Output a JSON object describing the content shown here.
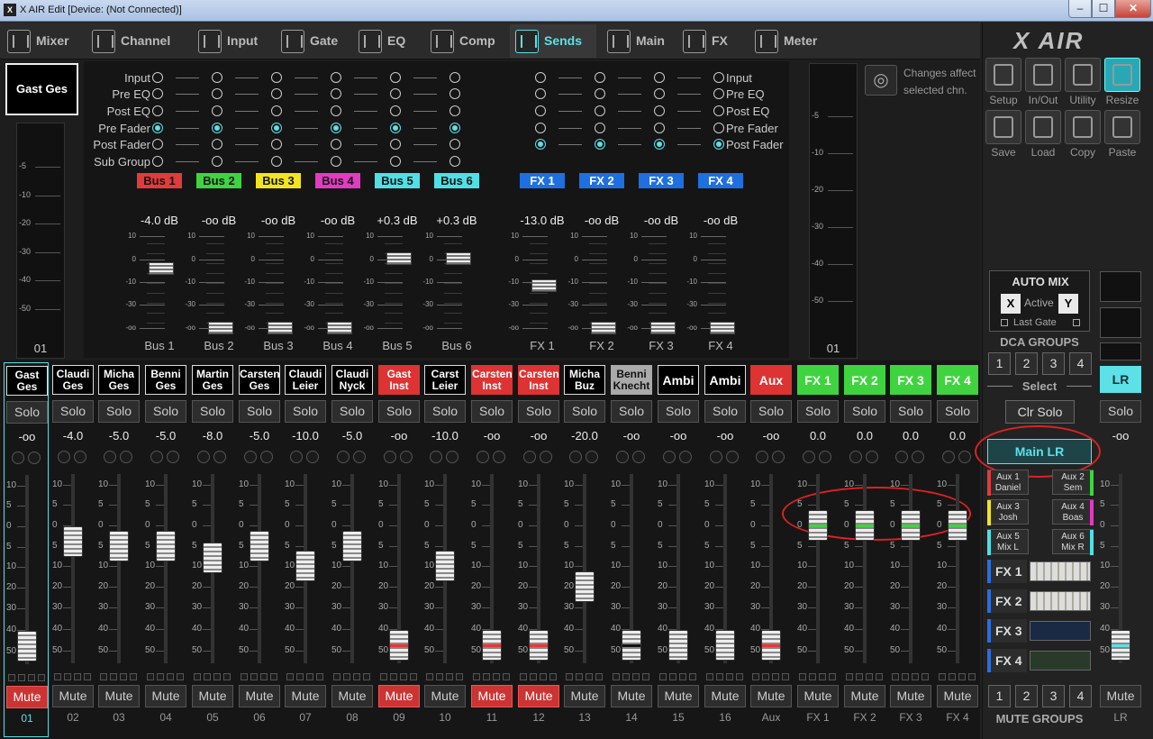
{
  "window": {
    "title": "X AIR Edit [Device: (Not Connected)]",
    "icon": "X",
    "min": "–",
    "max": "☐",
    "close": "✕"
  },
  "tabs": [
    {
      "label": "Mixer",
      "icon": "mixer-icon"
    },
    {
      "label": "Channel",
      "icon": "channel-icon"
    },
    {
      "label": "Input",
      "icon": "input-icon"
    },
    {
      "label": "Gate",
      "icon": "gate-icon"
    },
    {
      "label": "EQ",
      "icon": "eq-icon"
    },
    {
      "label": "Comp",
      "icon": "comp-icon"
    },
    {
      "label": "Sends",
      "icon": "sends-icon"
    },
    {
      "label": "Main",
      "icon": "main-icon"
    },
    {
      "label": "FX",
      "icon": "fx-icon"
    },
    {
      "label": "Meter",
      "icon": "meter-icon"
    }
  ],
  "active_tab": "Sends",
  "selected_channel": {
    "name": "Gast  Ges",
    "number": "01"
  },
  "meter_scale": [
    "-5",
    "-10",
    "-20",
    "-30",
    "-40",
    "-50"
  ],
  "right_meter_scale": [
    "-5",
    "-10",
    "-20",
    "-30",
    "-40",
    "-50"
  ],
  "tap_labels": [
    "Input",
    "Pre EQ",
    "Post EQ",
    "Pre Fader",
    "Post Fader",
    "Sub Group"
  ],
  "fx_tap_labels": [
    "Input",
    "Pre EQ",
    "Post EQ",
    "Pre Fader",
    "Post Fader"
  ],
  "buses": [
    {
      "name": "Bus 1",
      "color": "#e23b3b",
      "db": "-4.0 dB",
      "level": -4.0,
      "tap": "Pre Fader"
    },
    {
      "name": "Bus 2",
      "color": "#3fd43f",
      "db": "-oo dB",
      "level": null,
      "tap": "Pre Fader"
    },
    {
      "name": "Bus 3",
      "color": "#f2e41e",
      "db": "-oo dB",
      "level": null,
      "tap": "Pre Fader"
    },
    {
      "name": "Bus 4",
      "color": "#e23bc2",
      "db": "-oo dB",
      "level": null,
      "tap": "Pre Fader"
    },
    {
      "name": "Bus 5",
      "color": "#4fe0e6",
      "db": "+0.3 dB",
      "level": 0.3,
      "tap": "Pre Fader"
    },
    {
      "name": "Bus 6",
      "color": "#4fe0e6",
      "db": "+0.3 dB",
      "level": 0.3,
      "tap": "Pre Fader"
    }
  ],
  "fx_sends": [
    {
      "name": "FX 1",
      "color": "#1e6fe0",
      "db": "-13.0 dB",
      "level": -13.0,
      "tap": "Post Fader"
    },
    {
      "name": "FX 2",
      "color": "#1e6fe0",
      "db": "-oo dB",
      "level": null,
      "tap": "Post Fader"
    },
    {
      "name": "FX 3",
      "color": "#1e6fe0",
      "db": "-oo dB",
      "level": null,
      "tap": "Post Fader"
    },
    {
      "name": "FX 4",
      "color": "#1e6fe0",
      "db": "-oo dB",
      "level": null,
      "tap": "Post Fader"
    }
  ],
  "send_scale": [
    "10",
    "0",
    "-10",
    "-30",
    "-oo"
  ],
  "changes_note": "Changes affect selected chn.",
  "strip_scale": [
    "10",
    "5",
    "0",
    "5",
    "10",
    "20",
    "30",
    "40",
    "50"
  ],
  "channels": [
    {
      "name": "Gast\nGes",
      "solo": "Solo",
      "value": "-oo",
      "level": -90,
      "mute": "Mute",
      "muted": true,
      "number": "01",
      "name_bg": "#000",
      "line": "",
      "selected": true
    },
    {
      "name": "Claudi\nGes",
      "solo": "Solo",
      "value": "-4.0",
      "level": -4.0,
      "mute": "Mute",
      "muted": false,
      "number": "02",
      "name_bg": "#000",
      "line": ""
    },
    {
      "name": "Micha\nGes",
      "solo": "Solo",
      "value": "-5.0",
      "level": -5.0,
      "mute": "Mute",
      "muted": false,
      "number": "03",
      "name_bg": "#000",
      "line": ""
    },
    {
      "name": "Benni\nGes",
      "solo": "Solo",
      "value": "-5.0",
      "level": -5.0,
      "mute": "Mute",
      "muted": false,
      "number": "04",
      "name_bg": "#000",
      "line": ""
    },
    {
      "name": "Martin\nGes",
      "solo": "Solo",
      "value": "-8.0",
      "level": -8.0,
      "mute": "Mute",
      "muted": false,
      "number": "05",
      "name_bg": "#000",
      "line": ""
    },
    {
      "name": "Carsten\nGes",
      "solo": "Solo",
      "value": "-5.0",
      "level": -5.0,
      "mute": "Mute",
      "muted": false,
      "number": "06",
      "name_bg": "#000",
      "line": ""
    },
    {
      "name": "Claudi\nLeier",
      "solo": "Solo",
      "value": "-10.0",
      "level": -10.0,
      "mute": "Mute",
      "muted": false,
      "number": "07",
      "name_bg": "#000",
      "line": ""
    },
    {
      "name": "Claudi\nNyck",
      "solo": "Solo",
      "value": "-5.0",
      "level": -5.0,
      "mute": "Mute",
      "muted": false,
      "number": "08",
      "name_bg": "#000",
      "line": ""
    },
    {
      "name": "Gast\nInst",
      "solo": "Solo",
      "value": "-oo",
      "level": -90,
      "mute": "Mute",
      "muted": true,
      "number": "09",
      "name_bg": "#d33",
      "line": "#e33"
    },
    {
      "name": "Carst\nLeier",
      "solo": "Solo",
      "value": "-10.0",
      "level": -10.0,
      "mute": "Mute",
      "muted": false,
      "number": "10",
      "name_bg": "#000",
      "line": ""
    },
    {
      "name": "Carsten\nInst",
      "solo": "Solo",
      "value": "-oo",
      "level": -90,
      "mute": "Mute",
      "muted": true,
      "number": "11",
      "name_bg": "#d33",
      "line": "#e33"
    },
    {
      "name": "Carsten\nInst",
      "solo": "Solo",
      "value": "-oo",
      "level": -90,
      "mute": "Mute",
      "muted": true,
      "number": "12",
      "name_bg": "#d33",
      "line": "#e33"
    },
    {
      "name": "Micha\nBuz",
      "solo": "Solo",
      "value": "-20.0",
      "level": -20.0,
      "mute": "Mute",
      "muted": false,
      "number": "13",
      "name_bg": "#000",
      "line": ""
    },
    {
      "name": "Benni\nKnecht",
      "solo": "Solo",
      "value": "-oo",
      "level": -90,
      "mute": "Mute",
      "muted": false,
      "number": "14",
      "name_bg": "#aaa",
      "line": "#111"
    },
    {
      "name": "Ambi",
      "solo": "Solo",
      "value": "-oo",
      "level": -90,
      "mute": "Mute",
      "muted": false,
      "number": "15",
      "name_bg": "#000",
      "line": ""
    },
    {
      "name": "Ambi",
      "solo": "Solo",
      "value": "-oo",
      "level": -90,
      "mute": "Mute",
      "muted": false,
      "number": "16",
      "name_bg": "#000",
      "line": ""
    },
    {
      "name": "Aux",
      "solo": "Solo",
      "value": "-oo",
      "level": -90,
      "mute": "Mute",
      "muted": false,
      "number": "Aux",
      "name_bg": "#d33",
      "line": "#e33"
    },
    {
      "name": "FX 1",
      "solo": "Solo",
      "value": "0.0",
      "level": 0,
      "mute": "Mute",
      "muted": false,
      "number": "FX 1",
      "name_bg": "#3fd43f",
      "line": "#3fd43f"
    },
    {
      "name": "FX 2",
      "solo": "Solo",
      "value": "0.0",
      "level": 0,
      "mute": "Mute",
      "muted": false,
      "number": "FX 2",
      "name_bg": "#3fd43f",
      "line": "#3fd43f"
    },
    {
      "name": "FX 3",
      "solo": "Solo",
      "value": "0.0",
      "level": 0,
      "mute": "Mute",
      "muted": false,
      "number": "FX 3",
      "name_bg": "#3fd43f",
      "line": "#3fd43f"
    },
    {
      "name": "FX 4",
      "solo": "Solo",
      "value": "0.0",
      "level": 0,
      "mute": "Mute",
      "muted": false,
      "number": "FX 4",
      "name_bg": "#3fd43f",
      "line": "#3fd43f"
    }
  ],
  "lr_strip": {
    "name": "LR",
    "solo": "Solo",
    "value": "-oo",
    "level": -90,
    "mute": "Mute",
    "number": "LR"
  },
  "logo": "X AIR",
  "tools": [
    {
      "label": "Setup"
    },
    {
      "label": "In/Out"
    },
    {
      "label": "Utility"
    },
    {
      "label": "Resize"
    },
    {
      "label": "Save"
    },
    {
      "label": "Load"
    },
    {
      "label": "Copy"
    },
    {
      "label": "Paste"
    }
  ],
  "automix": {
    "title": "AUTO MIX",
    "x": "X",
    "active": "Active",
    "y": "Y",
    "last_gate": "Last Gate"
  },
  "dca": {
    "title": "DCA GROUPS",
    "buttons": [
      "1",
      "2",
      "3",
      "4"
    ]
  },
  "select_title": "Select",
  "clr_solo": "Clr Solo",
  "main_lr": "Main LR",
  "aux_buttons": [
    {
      "label": "Aux 1\nDaniel",
      "color": "#e23b3b"
    },
    {
      "label": "Aux 2\nSem",
      "color": "#3fd43f"
    },
    {
      "label": "Aux 3\nJosh",
      "color": "#f2e41e"
    },
    {
      "label": "Aux 4\nBoas",
      "color": "#e23bc2"
    },
    {
      "label": "Aux 5\nMix L",
      "color": "#4fe0e6"
    },
    {
      "label": "Aux 6\nMix R",
      "color": "#4fe0e6"
    }
  ],
  "fx_buttons": [
    "FX 1",
    "FX 2",
    "FX 3",
    "FX 4"
  ],
  "mute_groups": {
    "title": "MUTE GROUPS",
    "buttons": [
      "1",
      "2",
      "3",
      "4"
    ]
  }
}
